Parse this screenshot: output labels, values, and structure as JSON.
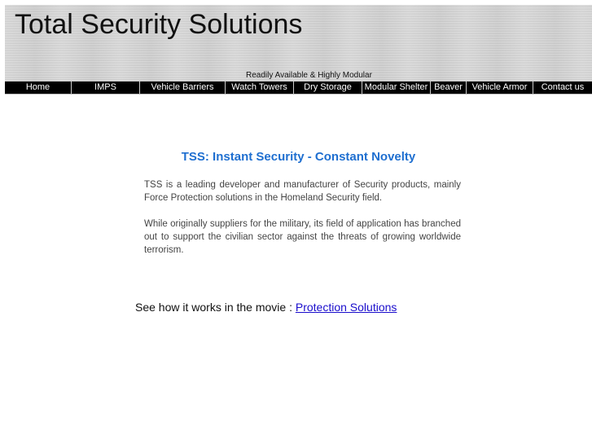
{
  "header": {
    "title": "Total Security Solutions",
    "tagline": "Readily Available & Highly Modular"
  },
  "nav": {
    "items": [
      {
        "label": "Home"
      },
      {
        "label": "IMPS"
      },
      {
        "label": "Vehicle Barriers"
      },
      {
        "label": "Watch Towers"
      },
      {
        "label": "Dry Storage"
      },
      {
        "label": "Modular Shelter"
      },
      {
        "label": "Beaver"
      },
      {
        "label": "Vehicle Armor"
      },
      {
        "label": "Contact us"
      }
    ]
  },
  "main": {
    "headline": "TSS: Instant Security - Constant Novelty",
    "paragraphs": [
      "TSS is a leading developer and manufacturer of Security products, mainly Force Protection solutions in the Homeland Security field.",
      "While originally suppliers for the military, its field of application has branched out to support the civilian sector against the threats of growing worldwide terrorism."
    ],
    "movie_prefix": "See how it works in the movie : ",
    "movie_link": "Protection Solutions"
  },
  "colors": {
    "headline": "#1f6fd0",
    "link": "#1a0dcc",
    "nav_bg": "#000000",
    "banner_bg": "#d3d3d3"
  }
}
